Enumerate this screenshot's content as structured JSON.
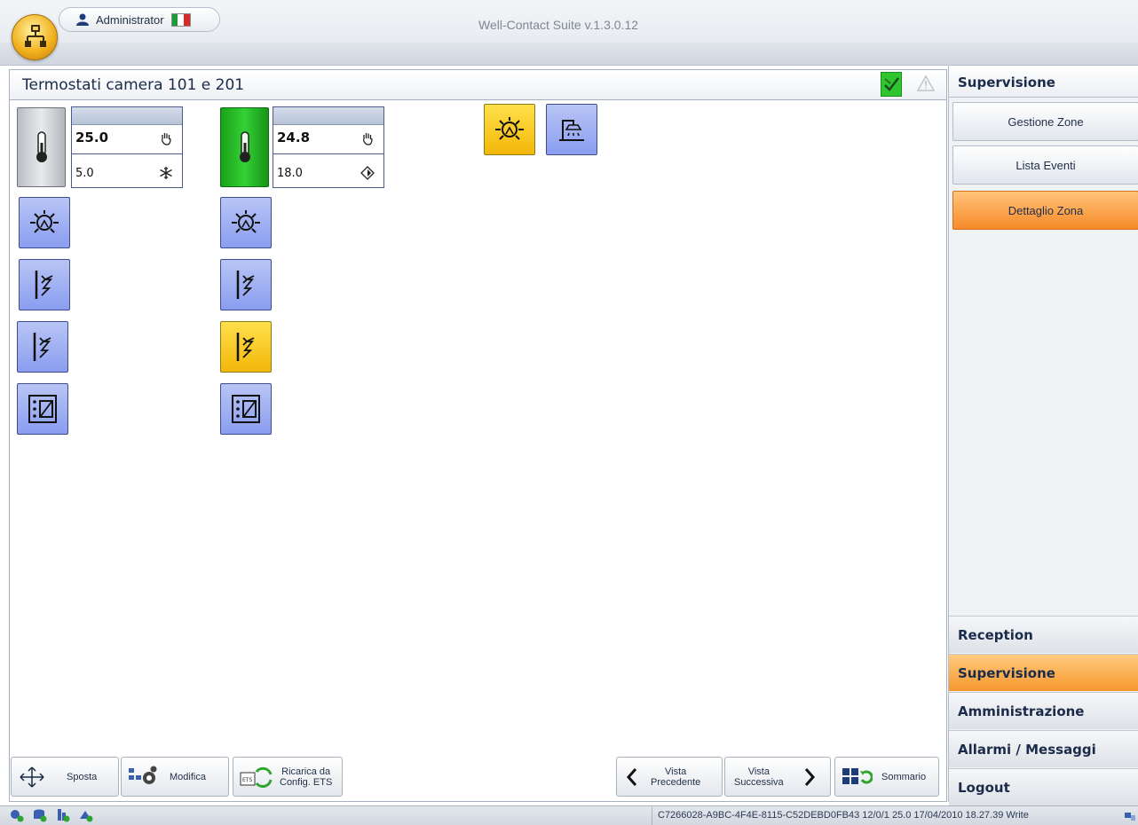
{
  "titlebar": {
    "user": "Administrator",
    "app_title": "Well-Contact Suite v.1.3.0.12"
  },
  "zone": {
    "title": "Termostati camera 101 e 201",
    "thermostats": [
      {
        "setpoint": "25.0",
        "measured": "5.0",
        "mode_icon": "hand-icon",
        "season_icon": "snowflake-icon",
        "state": "off"
      },
      {
        "setpoint": "24.8",
        "measured": "18.0",
        "mode_icon": "hand-icon",
        "season_icon": "diamond-icon",
        "state": "on"
      }
    ]
  },
  "toolbar": {
    "sposta": "Sposta",
    "modifica": "Modifica",
    "ricarica_line1": "Ricarica da",
    "ricarica_line2": "Config. ETS",
    "prev_line1": "Vista",
    "prev_line2": "Precedente",
    "next_line1": "Vista",
    "next_line2": "Successiva",
    "sommario": "Sommario"
  },
  "sidebar": {
    "header": "Supervisione",
    "items": [
      {
        "label": "Gestione Zone"
      },
      {
        "label": "Lista Eventi"
      },
      {
        "label": "Dettaglio Zona"
      }
    ],
    "categories": [
      {
        "label": "Reception"
      },
      {
        "label": "Supervisione"
      },
      {
        "label": "Amministrazione"
      },
      {
        "label": "Allarmi / Messaggi"
      },
      {
        "label": "Logout"
      }
    ]
  },
  "statusbar": {
    "text": "C7266028-A9BC-4F4E-8115-C52DEBD0FB43 12/0/1 25.0 17/04/2010 18.27.39 Write"
  },
  "colors": {
    "accent_orange": "#f78a2a",
    "tile_blue": "#8a9df0",
    "tile_yellow": "#f3b70a",
    "status_green": "#2ec52e"
  }
}
